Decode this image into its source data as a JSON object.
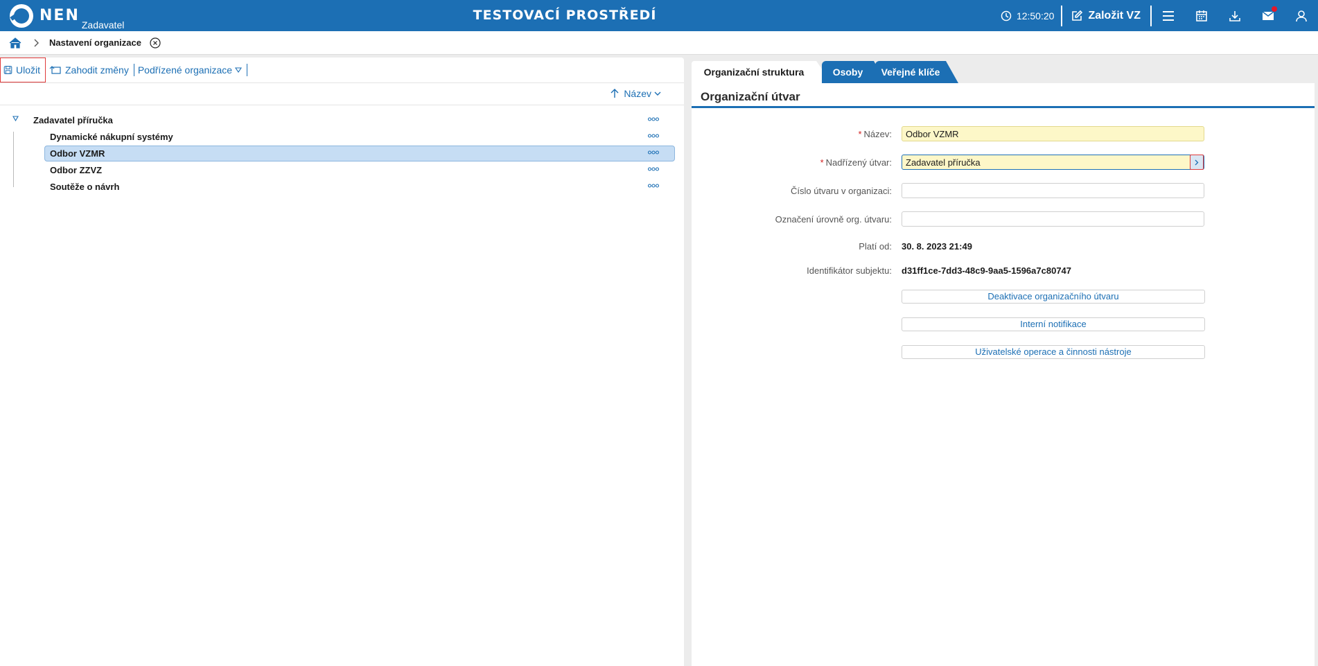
{
  "header": {
    "logo_text": "NEN",
    "logo_sub": "Zadavatel",
    "env_title": "TESTOVACÍ PROSTŘEDÍ",
    "clock": "12:50:20",
    "create_label": "Založit VZ",
    "icons": [
      "clock-icon",
      "edit-icon",
      "menu-icon",
      "calendar-icon",
      "download-icon",
      "mail-icon",
      "user-icon"
    ]
  },
  "breadcrumb": {
    "current": "Nastavení organizace"
  },
  "toolbar": {
    "save": "Uložit",
    "discard": "Zahodit změny",
    "sub_orgs": "Podřízené organizace"
  },
  "sort": {
    "label": "Název"
  },
  "tree": {
    "root": "Zadavatel příručka",
    "children": [
      "Dynamické nákupní systémy",
      "Odbor VZMR",
      "Odbor ZZVZ",
      "Soutěže o návrh"
    ],
    "selected": "Odbor VZMR"
  },
  "tabs": [
    "Organizační struktura",
    "Osoby",
    "Veřejné klíče"
  ],
  "form": {
    "title": "Organizační útvar",
    "required_mark": "*",
    "name_label": "Název:",
    "name_value": "Odbor VZMR",
    "parent_label": "Nadřízený útvar:",
    "parent_value": "Zadavatel příručka",
    "number_label": "Číslo útvaru v organizaci:",
    "number_value": "",
    "level_label": "Označení úrovně org. útvaru:",
    "level_value": "",
    "valid_from_label": "Platí od:",
    "valid_from_value": "30. 8. 2023 21:49",
    "subject_id_label": "Identifikátor subjektu:",
    "subject_id_value": "d31ff1ce-7dd3-48c9-9aa5-1596a7c80747",
    "btn_deactivate": "Deaktivace organizačního útvaru",
    "btn_notifications": "Interní notifikace",
    "btn_operations": "Uživatelské operace a činnosti nástroje"
  },
  "colors": {
    "brand": "#1c6fb4",
    "selection": "#c6ddf4",
    "required_field": "#fdf7c8",
    "notification": "#e5182a"
  }
}
